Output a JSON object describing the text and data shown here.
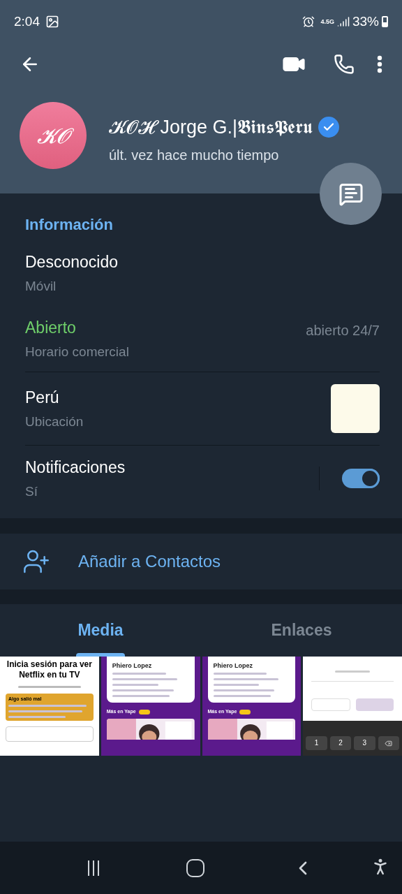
{
  "status_bar": {
    "time": "2:04",
    "network": "4.5G",
    "battery": "33%"
  },
  "profile": {
    "avatar_initials": "𝓚𝓞",
    "name": "𝓚𝓞𝓗 Jorge G.|𝕭𝖎𝖓𝖘𝕻𝖊𝖗𝖚",
    "verified": true,
    "last_seen": "últ. vez hace mucho tiempo"
  },
  "info": {
    "heading": "Información",
    "rows": [
      {
        "kind": "text",
        "value": "Desconocido",
        "label": "Móvil"
      },
      {
        "kind": "hours",
        "value": "Abierto",
        "label": "Horario comercial",
        "detail": "abierto 24/7"
      },
      {
        "kind": "location",
        "value": "Perú",
        "label": "Ubicación"
      },
      {
        "kind": "toggle",
        "value": "Notificaciones",
        "label": "Sí",
        "on": true
      }
    ]
  },
  "add_contact": {
    "label": "Añadir a Contactos"
  },
  "tabs": [
    {
      "label": "Media",
      "selected": true
    },
    {
      "label": "Enlaces",
      "selected": false
    }
  ],
  "media": [
    {
      "kind": "login",
      "title": "Inicia sesión para ver Netflix en tu TV",
      "alert": "Algo salió mal"
    },
    {
      "kind": "receipt",
      "name": "Phiero Lopez",
      "promo": "Más en Yape"
    },
    {
      "kind": "receipt",
      "name": "Phiero Lopez",
      "promo": "Más en Yape"
    },
    {
      "kind": "keyboard",
      "keys": [
        "1",
        "2",
        "3"
      ]
    }
  ]
}
